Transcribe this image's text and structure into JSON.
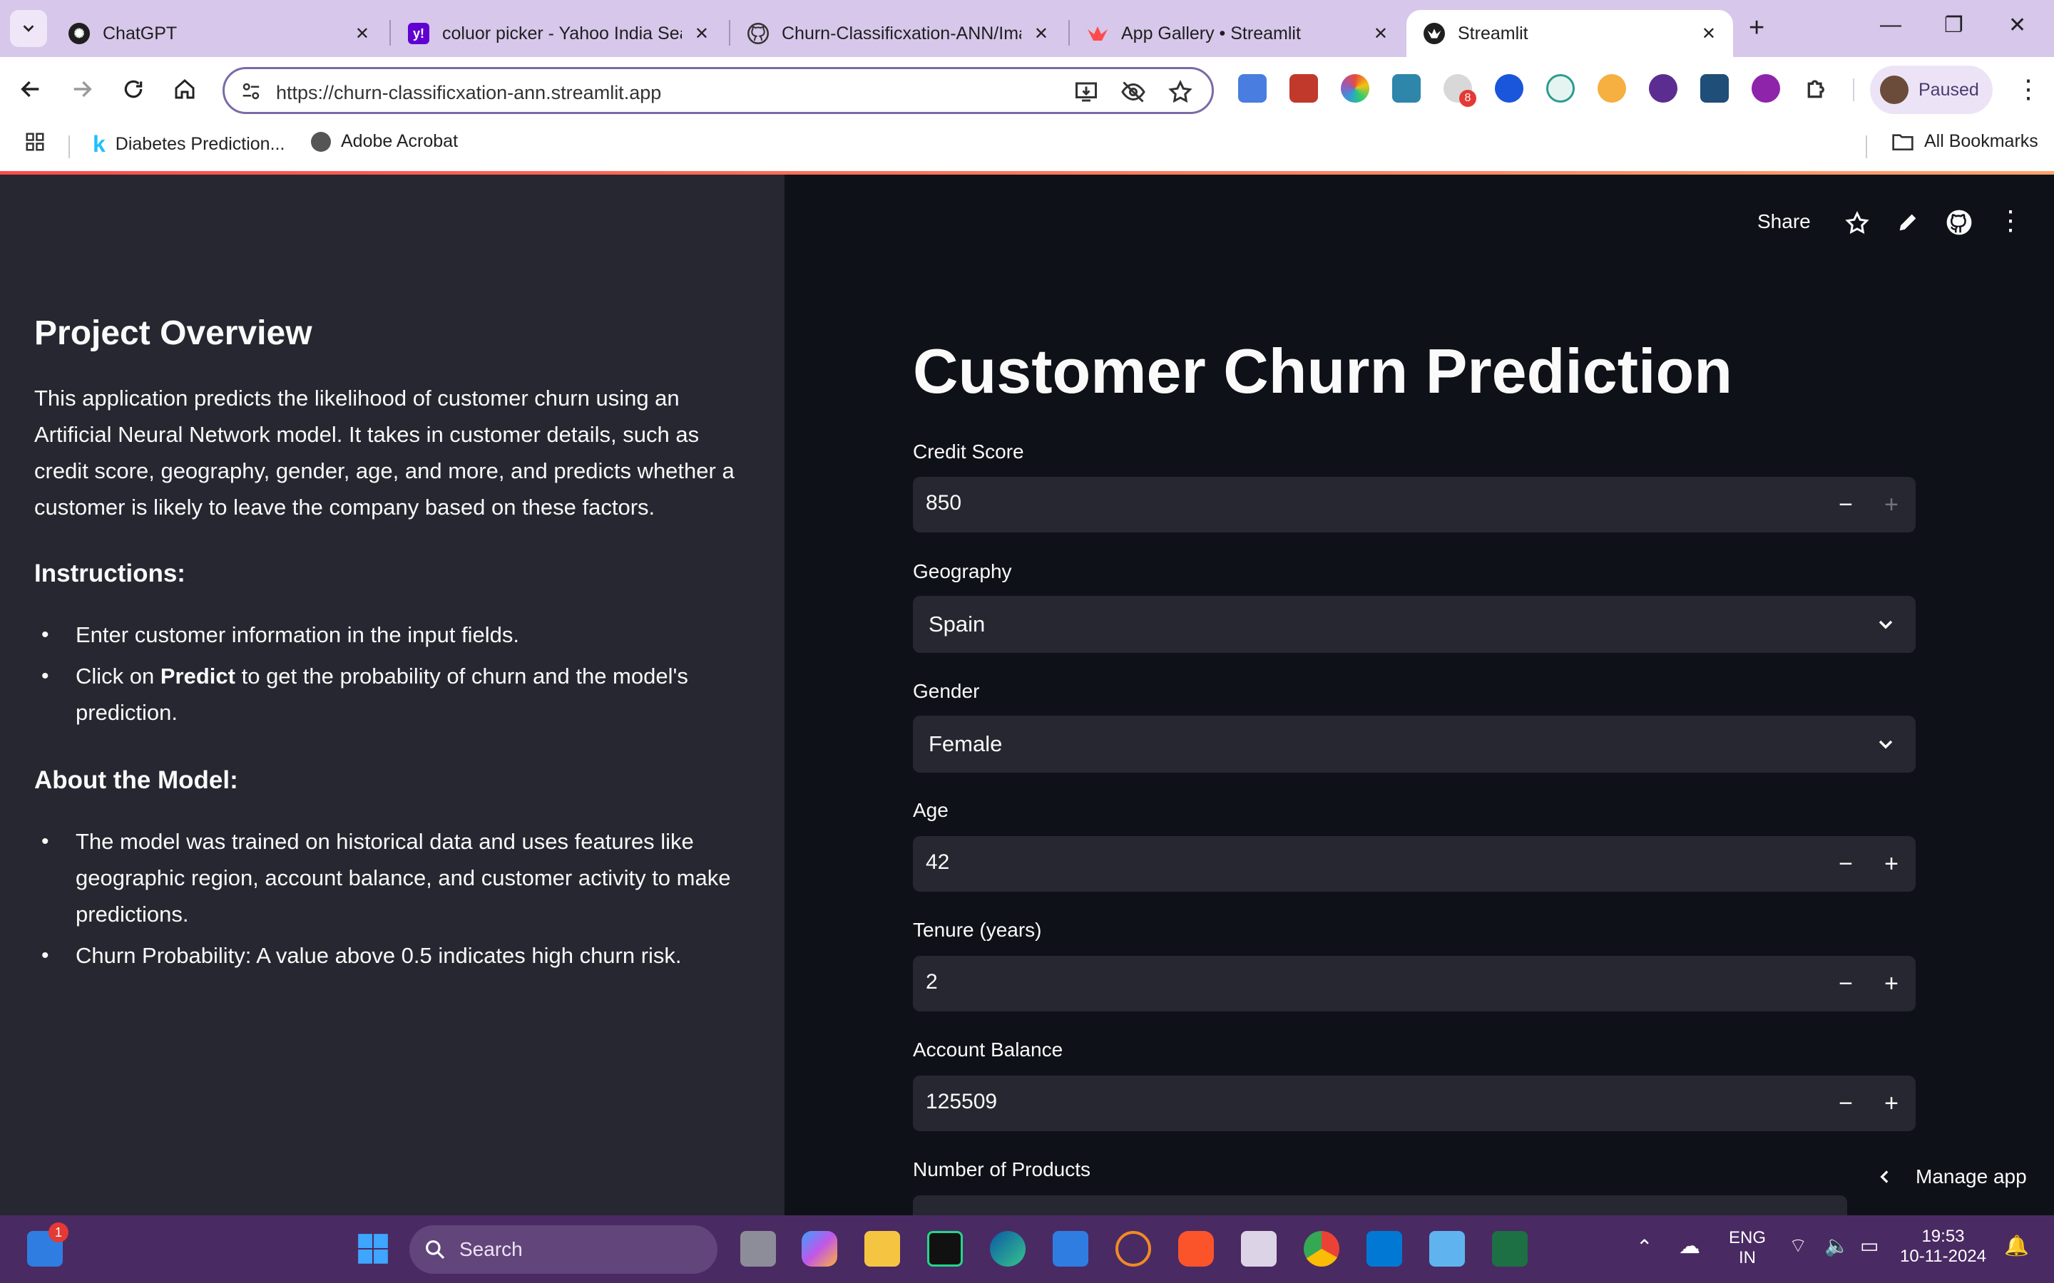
{
  "browser": {
    "tabs": [
      {
        "title": "ChatGPT",
        "favicon": "chatgpt-icon",
        "active": false
      },
      {
        "title": "coluor picker - Yahoo India Sea",
        "favicon": "yahoo-icon",
        "active": false
      },
      {
        "title": "Churn-Classificxation-ANN/Ima",
        "favicon": "github-icon",
        "active": false
      },
      {
        "title": "App Gallery • Streamlit",
        "favicon": "streamlit-icon",
        "active": false
      },
      {
        "title": "Streamlit",
        "favicon": "streamlit-icon",
        "active": true
      }
    ],
    "url": "https://churn-classificxation-ann.streamlit.app",
    "profile_status": "Paused",
    "extension_badge": "8",
    "bookmarks": [
      {
        "label": "Diabetes Prediction...",
        "icon": "kaggle-icon"
      },
      {
        "label": "Adobe Acrobat",
        "icon": "globe-icon"
      }
    ],
    "all_bookmarks_label": "All Bookmarks"
  },
  "sidebar": {
    "overview_title": "Project Overview",
    "overview_text": "This application predicts the likelihood of customer churn using an Artificial Neural Network model. It takes in customer details, such as credit score, geography, gender, age, and more, and predicts whether a customer is likely to leave the company based on these factors.",
    "instructions_title": "Instructions:",
    "instructions": {
      "item1": "Enter customer information in the input fields.",
      "item2_prefix": "Click on ",
      "item2_bold": "Predict",
      "item2_suffix": " to get the probability of churn and the model's prediction."
    },
    "about_title": "About the Model:",
    "about": [
      "The model was trained on historical data and uses features like geographic region, account balance, and customer activity to make predictions.",
      "Churn Probability: A value above 0.5 indicates high churn risk."
    ]
  },
  "main": {
    "share_label": "Share",
    "title": "Customer Churn Prediction",
    "fields": {
      "credit_score": {
        "label": "Credit Score",
        "value": "850"
      },
      "geography": {
        "label": "Geography",
        "value": "Spain"
      },
      "gender": {
        "label": "Gender",
        "value": "Female"
      },
      "age": {
        "label": "Age",
        "value": "42"
      },
      "tenure": {
        "label": "Tenure (years)",
        "value": "2"
      },
      "balance": {
        "label": "Account Balance",
        "value": "125509"
      },
      "num_products": {
        "label": "Number of Products"
      }
    },
    "manage_app_label": "Manage app"
  },
  "taskbar": {
    "search_label": "Search",
    "widgets_badge": "1",
    "lang_top": "ENG",
    "lang_bottom": "IN",
    "time": "19:53",
    "date": "10-11-2024"
  },
  "colors": {
    "sidebar_bg": "#262730",
    "main_bg": "#0e1117",
    "input_bg": "#262730",
    "text": "#fafafa",
    "accent": "#ff4b4b",
    "tabstrip": "#d7c7ea",
    "taskbar": "#4a2a63"
  }
}
